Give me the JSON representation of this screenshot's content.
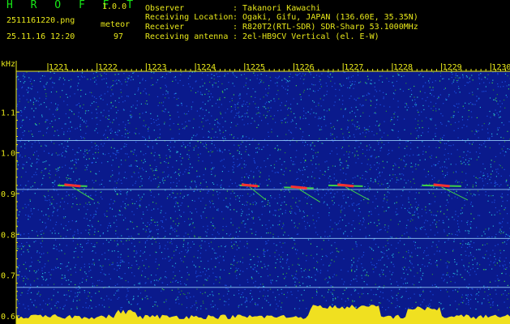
{
  "header": {
    "app_title": "H R O F F T",
    "app_version": "1.0.0",
    "file_name": "2511161220.png",
    "observation_time": "25.11.16 12:20",
    "meteor_label": "meteor",
    "meteor_count": "97",
    "info": [
      {
        "key": "Observer",
        "value": ": Takanori Kawachi"
      },
      {
        "key": "Receiving Location",
        "value": ": Ogaki, Gifu, JAPAN (136.60E, 35.35N)"
      },
      {
        "key": "Receiver",
        "value": ": R820T2(RTL-SDR) SDR-Sharp 53.1000MHz"
      },
      {
        "key": "Receiving antenna",
        "value": ": 2el-HB9CV Vertical (el. E-W)"
      }
    ]
  },
  "chart_data": {
    "type": "heatmap",
    "title": "",
    "xlabel": "",
    "ylabel": "kHz",
    "x_tick_labels": [
      "1221",
      "1222",
      "1223",
      "1224",
      "1225",
      "1226",
      "1227",
      "1228",
      "1229",
      "1230"
    ],
    "y_tick_labels": [
      "1.1",
      "1.0",
      "0.9",
      "0.8",
      "0.7",
      "0.6"
    ],
    "ylim": [
      0.58,
      1.2
    ],
    "xlim": [
      "12:20",
      "12:30"
    ],
    "background_color": "#0a1a8c",
    "noise_colors": [
      "#1c4fe0",
      "#27b8d8",
      "#2a8c3c",
      "#3fd04a"
    ],
    "spectrum_color": "#f0e020",
    "horizontal_carrier_lines_khz": [
      1.03,
      0.91,
      0.79,
      0.67
    ],
    "meteor_echo_regions": [
      {
        "start_min": 0.2,
        "end_min": 0.8,
        "freq_khz": 0.92
      },
      {
        "start_min": 3.9,
        "end_min": 4.3,
        "freq_khz": 0.92
      },
      {
        "start_min": 4.8,
        "end_min": 5.4,
        "freq_khz": 0.915
      },
      {
        "start_min": 5.7,
        "end_min": 6.4,
        "freq_khz": 0.92
      },
      {
        "start_min": 7.6,
        "end_min": 8.4,
        "freq_khz": 0.92
      }
    ]
  }
}
